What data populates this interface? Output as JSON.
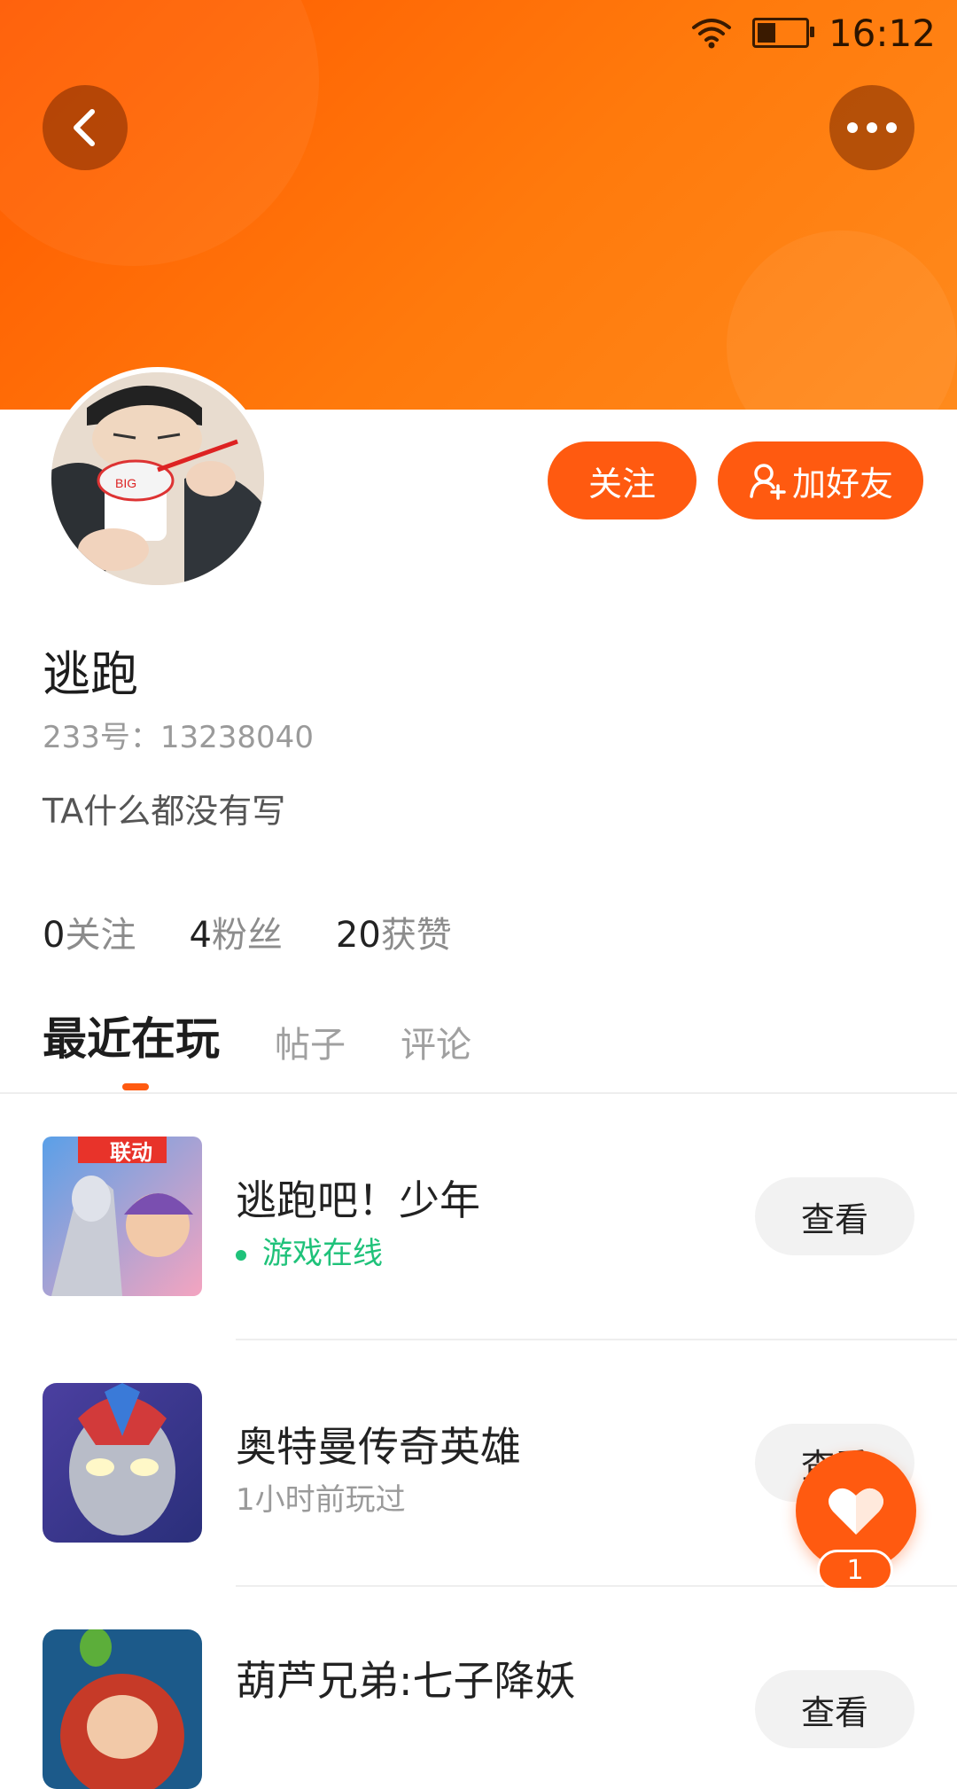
{
  "status_bar": {
    "time": "16:12",
    "icons": [
      "wifi-icon",
      "battery-icon"
    ],
    "battery_level": 0.35
  },
  "header": {
    "back_icon": "chevron-left-icon",
    "more_icon": "more-dots-icon"
  },
  "profile": {
    "follow_label": "关注",
    "add_friend_label": "加好友",
    "add_friend_icon": "add-user-icon",
    "name": "逃跑",
    "id_text": "233号：13238040",
    "bio": "TA什么都没有写",
    "stats": [
      {
        "num": "0",
        "label": "关注"
      },
      {
        "num": "4",
        "label": "粉丝"
      },
      {
        "num": "20",
        "label": "获赞"
      }
    ]
  },
  "tabs": [
    {
      "label": "最近在玩",
      "active": true
    },
    {
      "label": "帖子",
      "active": false
    },
    {
      "label": "评论",
      "active": false
    }
  ],
  "games": [
    {
      "title": "逃跑吧！少年",
      "subtitle": "游戏在线",
      "badge": "联动",
      "online": true,
      "button": "查看"
    },
    {
      "title": "奥特曼传奇英雄",
      "subtitle": "1小时前玩过",
      "online": false,
      "button": "查看"
    },
    {
      "title": "葫芦兄弟:七子降妖",
      "subtitle": "",
      "online": false,
      "button": "查看"
    }
  ],
  "fab": {
    "icon": "heart-icon",
    "badge": "1"
  },
  "colors": {
    "accent": "#ff5a10",
    "online": "#1fc27a",
    "muted": "#9a9a9a"
  }
}
